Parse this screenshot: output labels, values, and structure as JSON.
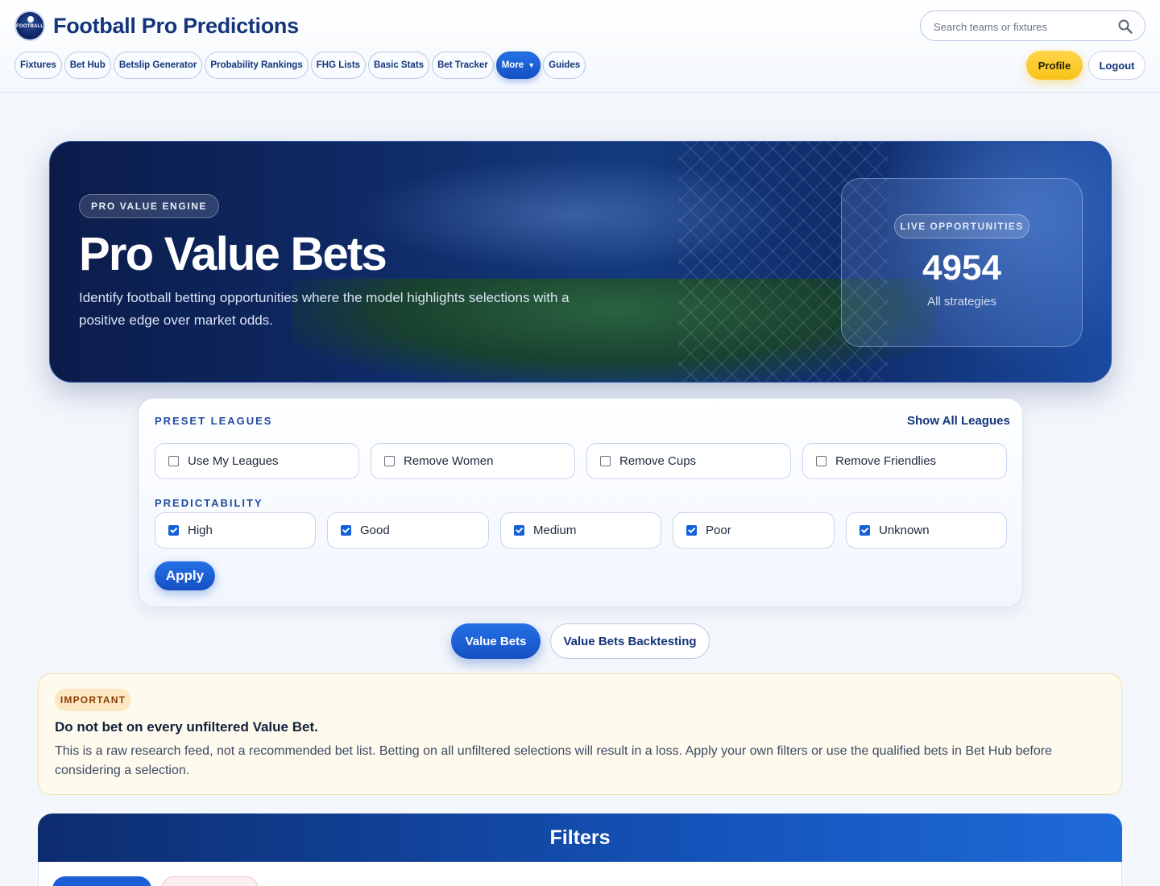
{
  "brand": {
    "name": "Football Pro Predictions",
    "logo_text": "FOOTBALL",
    "logo_icon": "soccer-ball-icon"
  },
  "search": {
    "placeholder": "Search teams or fixtures",
    "icon": "search-icon"
  },
  "nav": {
    "items": [
      {
        "label": "Fixtures"
      },
      {
        "label": "Bet Hub"
      },
      {
        "label": "Betslip Generator"
      },
      {
        "label": "Probability Rankings"
      },
      {
        "label": "FHG Lists"
      },
      {
        "label": "Basic Stats"
      },
      {
        "label": "Bet Tracker"
      },
      {
        "label": "More",
        "chevron": "▼",
        "active": true
      },
      {
        "label": "Guides"
      }
    ]
  },
  "account": {
    "profile_label": "Profile",
    "logout_label": "Logout"
  },
  "hero": {
    "badge": "PRO VALUE ENGINE",
    "title": "Pro Value Bets",
    "description": "Identify football betting opportunities where the model highlights selections with a positive edge over market odds.",
    "live": {
      "badge": "LIVE OPPORTUNITIES",
      "count": "4954",
      "subtitle": "All strategies"
    }
  },
  "preset_leagues": {
    "label": "PRESET LEAGUES",
    "show_all": "Show All Leagues",
    "options": [
      {
        "label": "Use My Leagues",
        "checked": false
      },
      {
        "label": "Remove Women",
        "checked": false
      },
      {
        "label": "Remove Cups",
        "checked": false
      },
      {
        "label": "Remove Friendlies",
        "checked": false
      }
    ]
  },
  "predictability": {
    "label": "PREDICTABILITY",
    "options": [
      {
        "label": "High",
        "checked": true
      },
      {
        "label": "Good",
        "checked": true
      },
      {
        "label": "Medium",
        "checked": true
      },
      {
        "label": "Poor",
        "checked": true
      },
      {
        "label": "Unknown",
        "checked": true
      }
    ],
    "apply_label": "Apply"
  },
  "tabs": {
    "primary": "Value Bets",
    "secondary": "Value Bets Backtesting"
  },
  "notice": {
    "badge": "IMPORTANT",
    "title": "Do not bet on every unfiltered Value Bet.",
    "body": "This is a raw research feed, not a recommended bet list. Betting on all unfiltered selections will result in a loss. Apply your own filters or use the qualified bets in Bet Hub before considering a selection."
  },
  "filters": {
    "title": "Filters"
  },
  "colors": {
    "brand_blue": "#13357a",
    "accent_blue": "#1560d8",
    "profile_yellow": "#f8c21a",
    "notice_bg": "#fffaee"
  }
}
